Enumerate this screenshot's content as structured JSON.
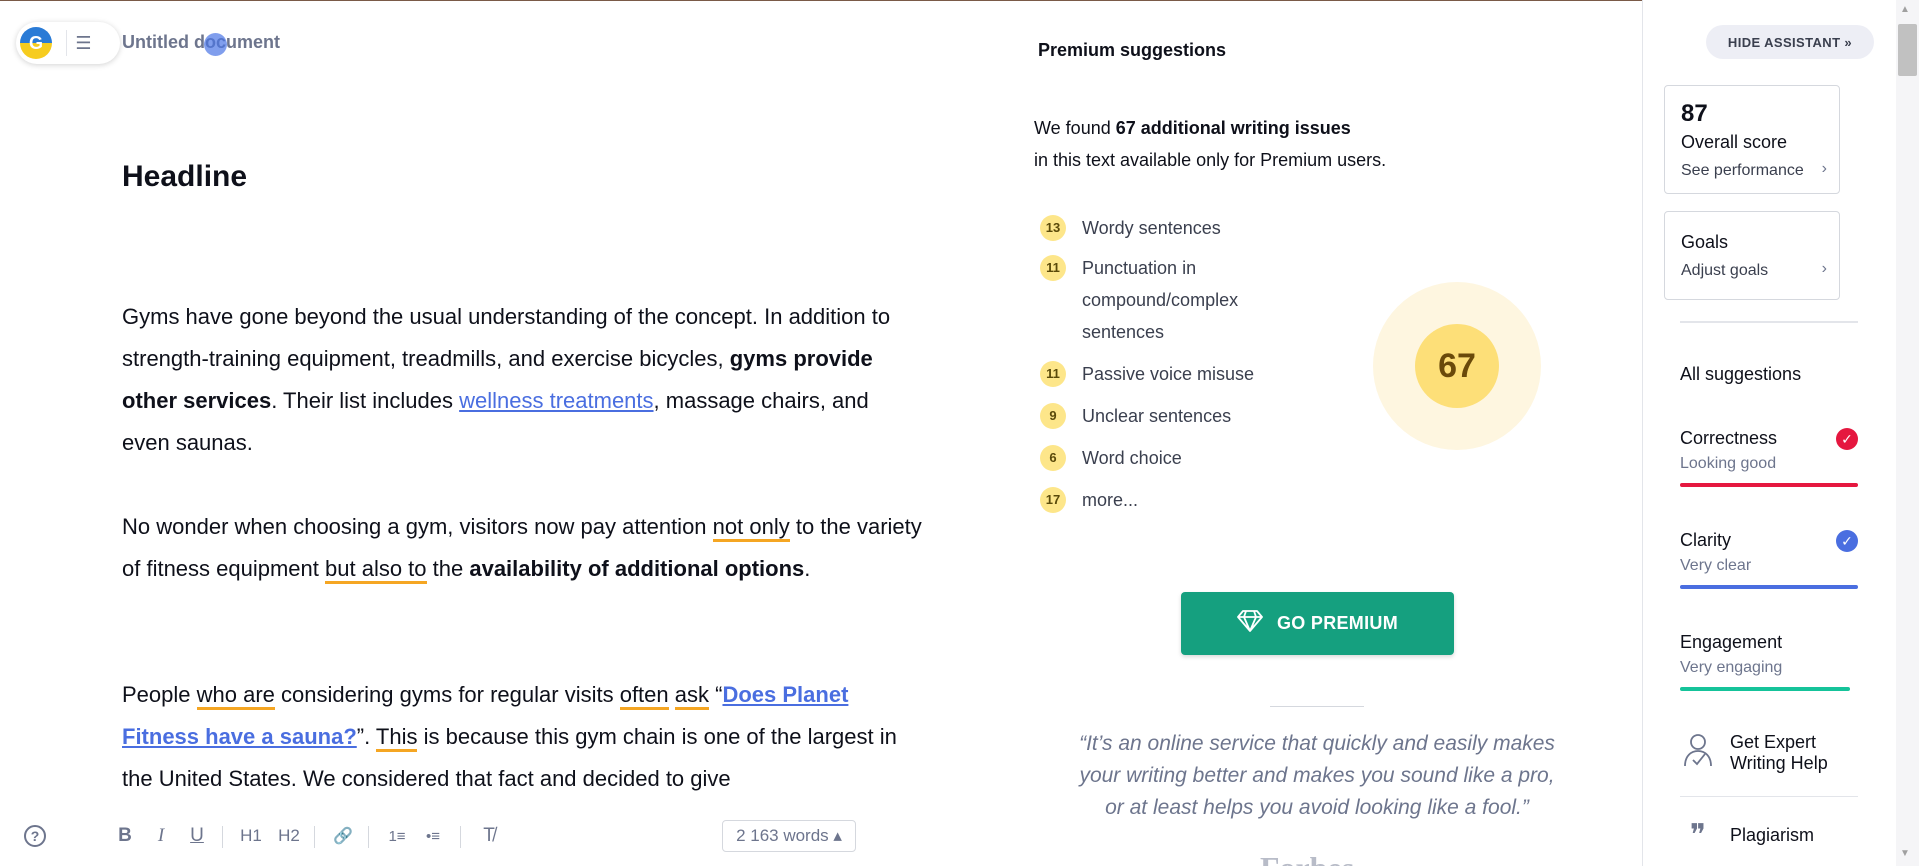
{
  "header": {
    "doc_title": "Untitled document",
    "logo_letter": "G",
    "menu_glyph": "☰"
  },
  "editor": {
    "headline": "Headline",
    "p1": {
      "t1": "Gyms have gone beyond the usual understanding of the concept. In addition to strength-training equipment, treadmills, and exercise bicycles, ",
      "b1": "gyms provide other services",
      "t2": ". Their list includes ",
      "link1": "wellness treatments",
      "t3": ", massage chairs, and even saunas."
    },
    "p2": {
      "t1": "No wonder when choosing a gym, visitors now pay attention ",
      "u1": "not only",
      "t2": " to the variety of fitness equipment ",
      "u2": "but also to",
      "t3": " the ",
      "b1": "availability of additional options",
      "t4": "."
    },
    "p3": {
      "t1": "People ",
      "u1": "who are",
      "t2": " considering gyms for regular visits ",
      "u2": "often",
      "t3": " ",
      "u3": "ask",
      "t4": " “",
      "link1": "Does Planet Fitness have a sauna?",
      "t5": "”. ",
      "u4": "This",
      "t6": " is because this gym chain is one of the largest in the United States. We considered that fact and decided to give"
    }
  },
  "toolbar": {
    "help": "?",
    "bold": "B",
    "italic": "I",
    "underline": "U",
    "h1": "H1",
    "h2": "H2",
    "link": "🔗",
    "ordered_list": "1≡",
    "bullet_list": "•≡",
    "clear_format": "T̸",
    "words": "2 163 words ▴"
  },
  "premium": {
    "title": "Premium suggestions",
    "intro_a": "We found ",
    "intro_bold": "67 additional writing issues",
    "intro_b": "in this text available only for Premium users.",
    "items": [
      {
        "count": "13",
        "label": "Wordy sentences"
      },
      {
        "count": "11",
        "label": "Punctuation in compound/complex sentences"
      },
      {
        "count": "11",
        "label": "Passive voice misuse"
      },
      {
        "count": "9",
        "label": "Unclear sentences"
      },
      {
        "count": "6",
        "label": "Word choice"
      },
      {
        "count": "17",
        "label": "more..."
      }
    ],
    "score": "67",
    "button": "GO PREMIUM",
    "quote": "“It’s an online service that quickly and easily makes your writing better and makes you sound like a pro, or at least helps you avoid looking like a fool.”",
    "quote_source": "Forbes"
  },
  "sidebar": {
    "hide_assistant": "HIDE ASSISTANT  »",
    "overall": {
      "score": "87",
      "title": "Overall score",
      "sub": "See performance"
    },
    "goals": {
      "title": "Goals",
      "sub": "Adjust goals"
    },
    "all_suggestions": "All suggestions",
    "categories": [
      {
        "title": "Correctness",
        "sub": "Looking good",
        "color": "#e5173f",
        "check": true
      },
      {
        "title": "Clarity",
        "sub": "Very clear",
        "color": "#4a6ee0",
        "check": true
      },
      {
        "title": "Engagement",
        "sub": "Very engaging",
        "color": "#15c39a",
        "check": false
      }
    ],
    "expert": "Get Expert Writing Help",
    "plagiarism": "Plagiarism"
  },
  "colors": {
    "accent_green": "#15a07f",
    "correctness": "#e5173f",
    "clarity": "#4a6ee0",
    "engagement": "#15c39a",
    "badge": "#fde68a"
  }
}
